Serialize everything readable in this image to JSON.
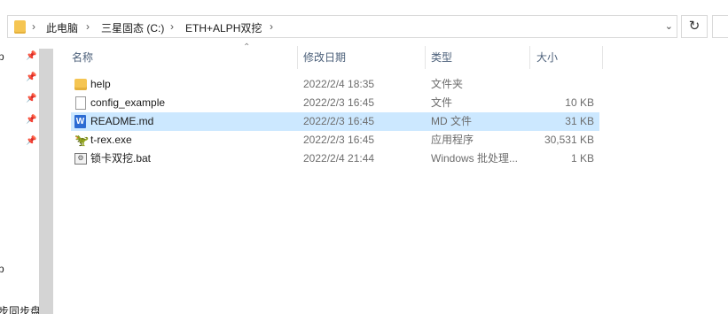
{
  "address_bar": {
    "breadcrumbs": [
      "此电脑",
      "三星固态 (C:)",
      "ETH+ALPH双挖"
    ],
    "dropdown_icon": "chevron-down-icon",
    "refresh_icon": "refresh-icon"
  },
  "nav": {
    "fragments": [
      "p",
      "p",
      "步同步盘"
    ],
    "pins": 5
  },
  "columns": {
    "name": "名称",
    "date": "修改日期",
    "type": "类型",
    "size": "大小"
  },
  "files": [
    {
      "name": "help",
      "date": "2022/2/4 18:35",
      "type": "文件夹",
      "size": "",
      "icon": "folder-icon",
      "selected": false
    },
    {
      "name": "config_example",
      "date": "2022/2/3 16:45",
      "type": "文件",
      "size": "10 KB",
      "icon": "file-icon",
      "selected": false
    },
    {
      "name": "README.md",
      "date": "2022/2/3 16:45",
      "type": "MD 文件",
      "size": "31 KB",
      "icon": "word-doc-icon",
      "selected": true
    },
    {
      "name": "t-rex.exe",
      "date": "2022/2/3 16:45",
      "type": "应用程序",
      "size": "30,531 KB",
      "icon": "trex-app-icon",
      "selected": false
    },
    {
      "name": "锁卡双挖.bat",
      "date": "2022/2/4 21:44",
      "type": "Windows 批处理...",
      "size": "1 KB",
      "icon": "batch-file-icon",
      "selected": false
    }
  ]
}
